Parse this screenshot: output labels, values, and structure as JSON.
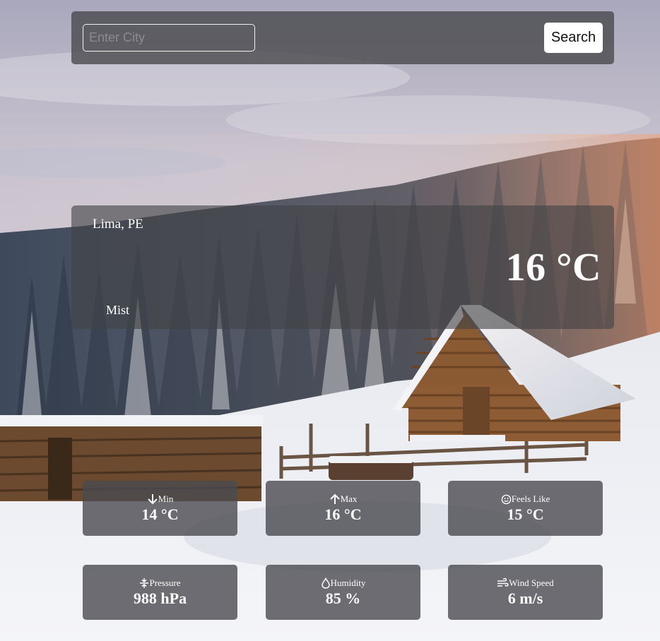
{
  "search": {
    "placeholder": "Enter City",
    "value": "",
    "button_label": "Search"
  },
  "weather": {
    "location": "Lima, PE",
    "temperature": "16 °C",
    "condition": "Mist"
  },
  "stats": {
    "min": {
      "label": "Min",
      "value": "14 °C",
      "icon": "arrow-down-icon"
    },
    "max": {
      "label": "Max",
      "value": "16 °C",
      "icon": "arrow-up-icon"
    },
    "feels": {
      "label": "Feels Like",
      "value": "15 °C",
      "icon": "smiley-icon"
    },
    "pressure": {
      "label": "Pressure",
      "value": "988 hPa",
      "icon": "pressure-icon"
    },
    "humidity": {
      "label": "Humidity",
      "value": "85 %",
      "icon": "droplet-icon"
    },
    "wind": {
      "label": "Wind Speed",
      "value": "6 m/s",
      "icon": "wind-icon"
    }
  },
  "colors": {
    "panel": "#46464a",
    "text": "#ffffff",
    "button_bg": "#ffffff"
  }
}
